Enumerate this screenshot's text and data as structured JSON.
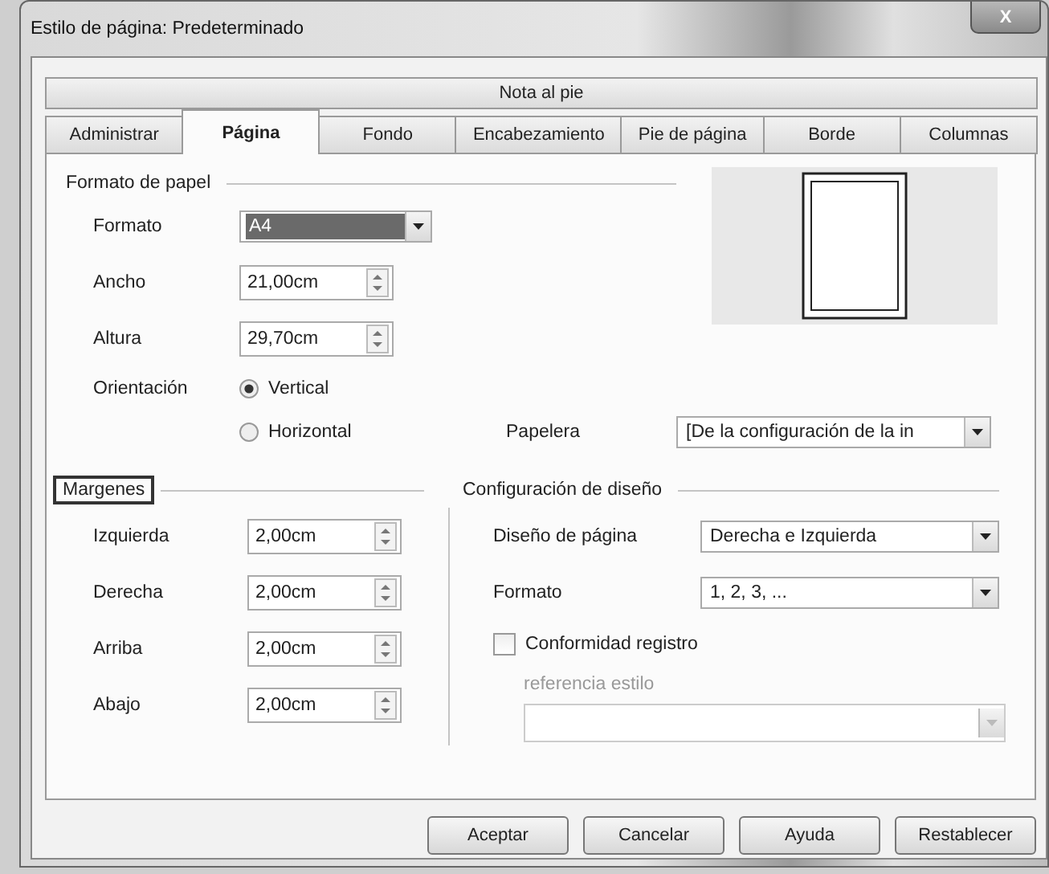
{
  "window": {
    "title": "Estilo de página: Predeterminado",
    "close_label": "X"
  },
  "tabs_row_1": [
    {
      "label": "Nota al pie",
      "selected": false
    }
  ],
  "tabs_row_2": [
    {
      "label": "Administrar",
      "selected": false
    },
    {
      "label": "Página",
      "selected": true
    },
    {
      "label": "Fondo",
      "selected": false
    },
    {
      "label": "Encabezamiento",
      "selected": false
    },
    {
      "label": "Pie de página",
      "selected": false
    },
    {
      "label": "Borde",
      "selected": false
    },
    {
      "label": "Columnas",
      "selected": false
    }
  ],
  "paper_format": {
    "title": "Formato de papel",
    "fields": [
      {
        "kind": "select",
        "label": "Formato",
        "value": "A4",
        "highlighted": true
      },
      {
        "kind": "spin",
        "label": "Ancho",
        "value": "21,00cm"
      },
      {
        "kind": "spin",
        "label": "Altura",
        "value": "29,70cm"
      }
    ],
    "orientation": {
      "label": "Orientación",
      "options": [
        {
          "label": "Vertical",
          "selected": true
        },
        {
          "label": "Horizontal",
          "selected": false
        }
      ]
    },
    "paper_tray": {
      "label": "Papelera",
      "value": "[De la configuración de la in"
    }
  },
  "margins": {
    "title": "Margenes",
    "outlined": true,
    "fields": [
      {
        "label": "Izquierda",
        "value": "2,00cm"
      },
      {
        "label": "Derecha",
        "value": "2,00cm"
      },
      {
        "label": "Arriba",
        "value": "2,00cm"
      },
      {
        "label": "Abajo",
        "value": "2,00cm"
      }
    ]
  },
  "layout_settings": {
    "title": "Configuración de diseño",
    "fields": [
      {
        "label": "Diseño de página",
        "value": "Derecha e Izquierda"
      },
      {
        "label": "Formato",
        "value": "1, 2, 3, ..."
      }
    ],
    "register_true": {
      "label": "Conformidad registro",
      "checked": false
    },
    "reference_style": {
      "label": "referencia estilo",
      "disabled": true
    }
  },
  "buttons": [
    {
      "label": "Aceptar"
    },
    {
      "label": "Cancelar"
    },
    {
      "label": "Ayuda"
    },
    {
      "label": "Restablecer"
    }
  ]
}
